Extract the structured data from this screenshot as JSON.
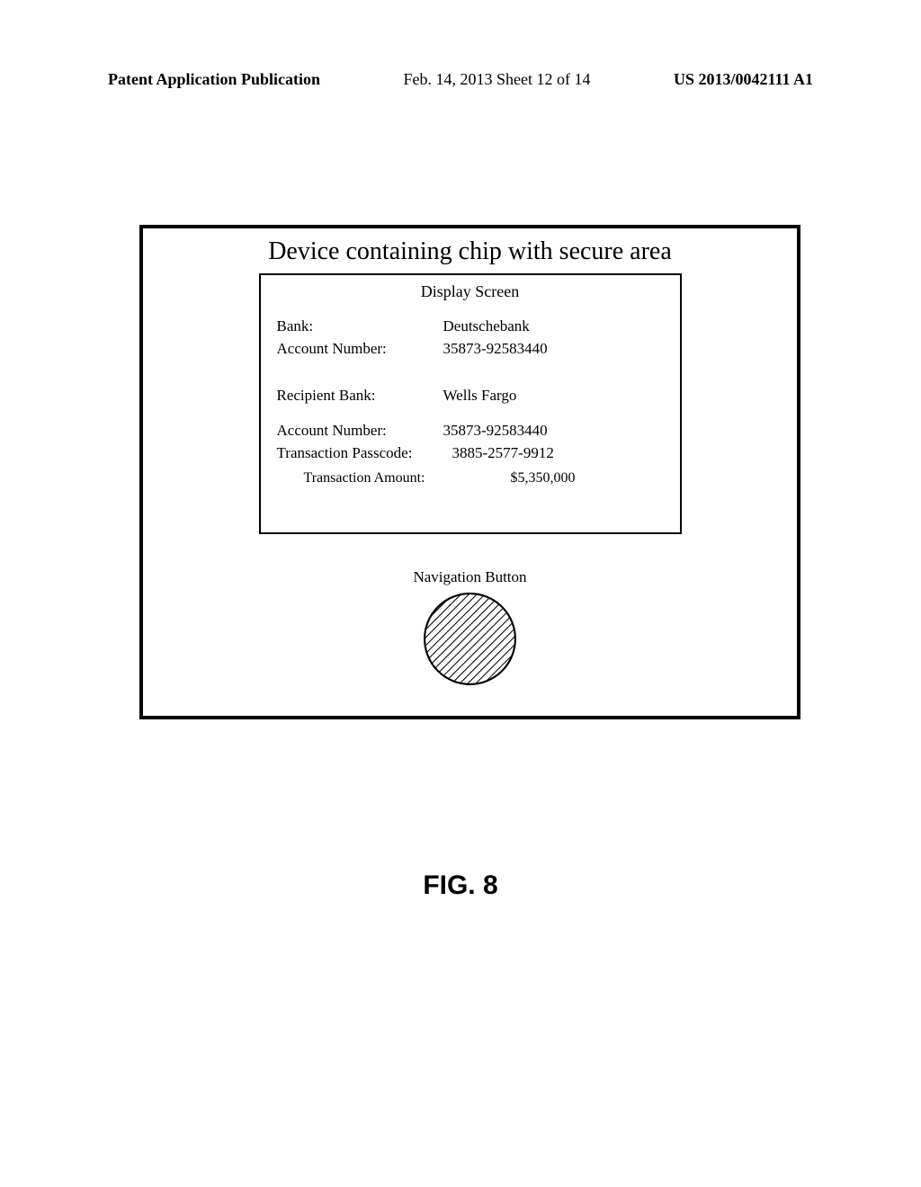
{
  "header": {
    "left": "Patent Application Publication",
    "center": "Feb. 14, 2013  Sheet 12 of 14",
    "right": "US 2013/0042111 A1"
  },
  "device": {
    "title": "Device containing chip with secure area",
    "screen_title": "Display Screen",
    "fields": {
      "bank_label": "Bank:",
      "bank_value": "Deutschebank",
      "acct_label": "Account Number:",
      "acct_value": "35873-92583440",
      "recipient_bank_label": "Recipient Bank:",
      "recipient_bank_value": "Wells Fargo",
      "acct2_label": "Account Number:",
      "acct2_value": "35873-92583440",
      "passcode_label": "Transaction Passcode:",
      "passcode_value": "3885-2577-9912",
      "amount_label": "Transaction Amount:",
      "amount_value": "$5,350,000"
    },
    "nav_label": "Navigation Button"
  },
  "figure_label": "FIG. 8"
}
